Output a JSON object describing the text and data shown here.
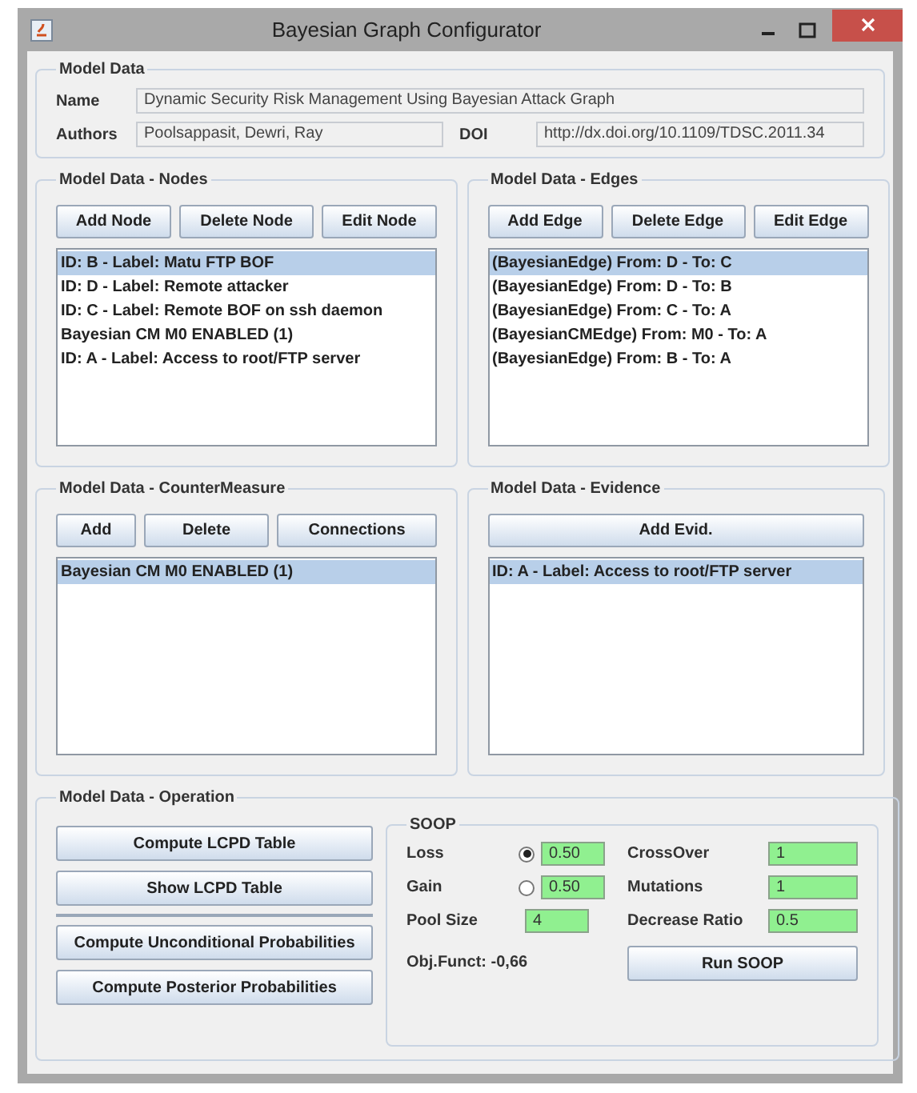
{
  "window": {
    "title": "Bayesian Graph Configurator"
  },
  "model_data": {
    "title": "Model Data",
    "name": {
      "label": "Name",
      "value": "Dynamic Security Risk Management Using Bayesian Attack Graph"
    },
    "authors": {
      "label": "Authors",
      "value": "Poolsappasit, Dewri, Ray"
    },
    "doi": {
      "label": "DOI",
      "value": "http://dx.doi.org/10.1109/TDSC.2011.34"
    }
  },
  "nodes": {
    "title": "Model Data - Nodes",
    "buttons": [
      "Add Node",
      "Delete Node",
      "Edit Node"
    ],
    "items": [
      {
        "text": "ID: B - Label: Matu FTP BOF",
        "selected": true
      },
      {
        "text": "ID: D - Label: Remote attacker",
        "selected": false
      },
      {
        "text": "ID: C - Label: Remote BOF on ssh daemon",
        "selected": false
      },
      {
        "text": "Bayesian CM M0 ENABLED (1)",
        "selected": false
      },
      {
        "text": "ID: A - Label: Access to root/FTP server",
        "selected": false
      }
    ]
  },
  "edges": {
    "title": "Model Data - Edges",
    "buttons": [
      "Add Edge",
      "Delete Edge",
      "Edit Edge"
    ],
    "items": [
      {
        "text": "(BayesianEdge) From: D - To: C",
        "selected": true
      },
      {
        "text": "(BayesianEdge) From: D - To: B",
        "selected": false
      },
      {
        "text": "(BayesianEdge) From: C - To: A",
        "selected": false
      },
      {
        "text": "(BayesianCMEdge) From: M0 - To: A",
        "selected": false
      },
      {
        "text": "(BayesianEdge) From: B - To: A",
        "selected": false
      }
    ]
  },
  "countermeasure": {
    "title": "Model Data - CounterMeasure",
    "buttons": [
      "Add",
      "Delete",
      "Connections"
    ],
    "items": [
      {
        "text": "Bayesian CM M0 ENABLED (1)",
        "selected": true
      }
    ]
  },
  "evidence": {
    "title": "Model Data - Evidence",
    "buttons": [
      "Add Evid."
    ],
    "items": [
      {
        "text": "ID: A - Label: Access to root/FTP server",
        "selected": true
      }
    ]
  },
  "operation": {
    "title": "Model Data - Operation",
    "button_groups": [
      [
        "Compute LCPD Table",
        "Show LCPD Table"
      ],
      [
        "Compute Unconditional Probabilities",
        "Compute Posterior Probabilities"
      ]
    ],
    "soop": {
      "title": "SOOP",
      "left": [
        {
          "kind": "radio",
          "label": "Loss",
          "value": "0.50",
          "selected": true
        },
        {
          "kind": "radio",
          "label": "Gain",
          "value": "0.50",
          "selected": false
        },
        {
          "kind": "plain",
          "label": "Pool Size",
          "value": "4"
        }
      ],
      "right": [
        {
          "label": "CrossOver",
          "value": "1"
        },
        {
          "label": "Mutations",
          "value": "1"
        },
        {
          "label": "Decrease Ratio",
          "value": "0.5"
        }
      ],
      "objective": "Obj.Funct: -0,66",
      "run_button": "Run SOOP"
    }
  }
}
